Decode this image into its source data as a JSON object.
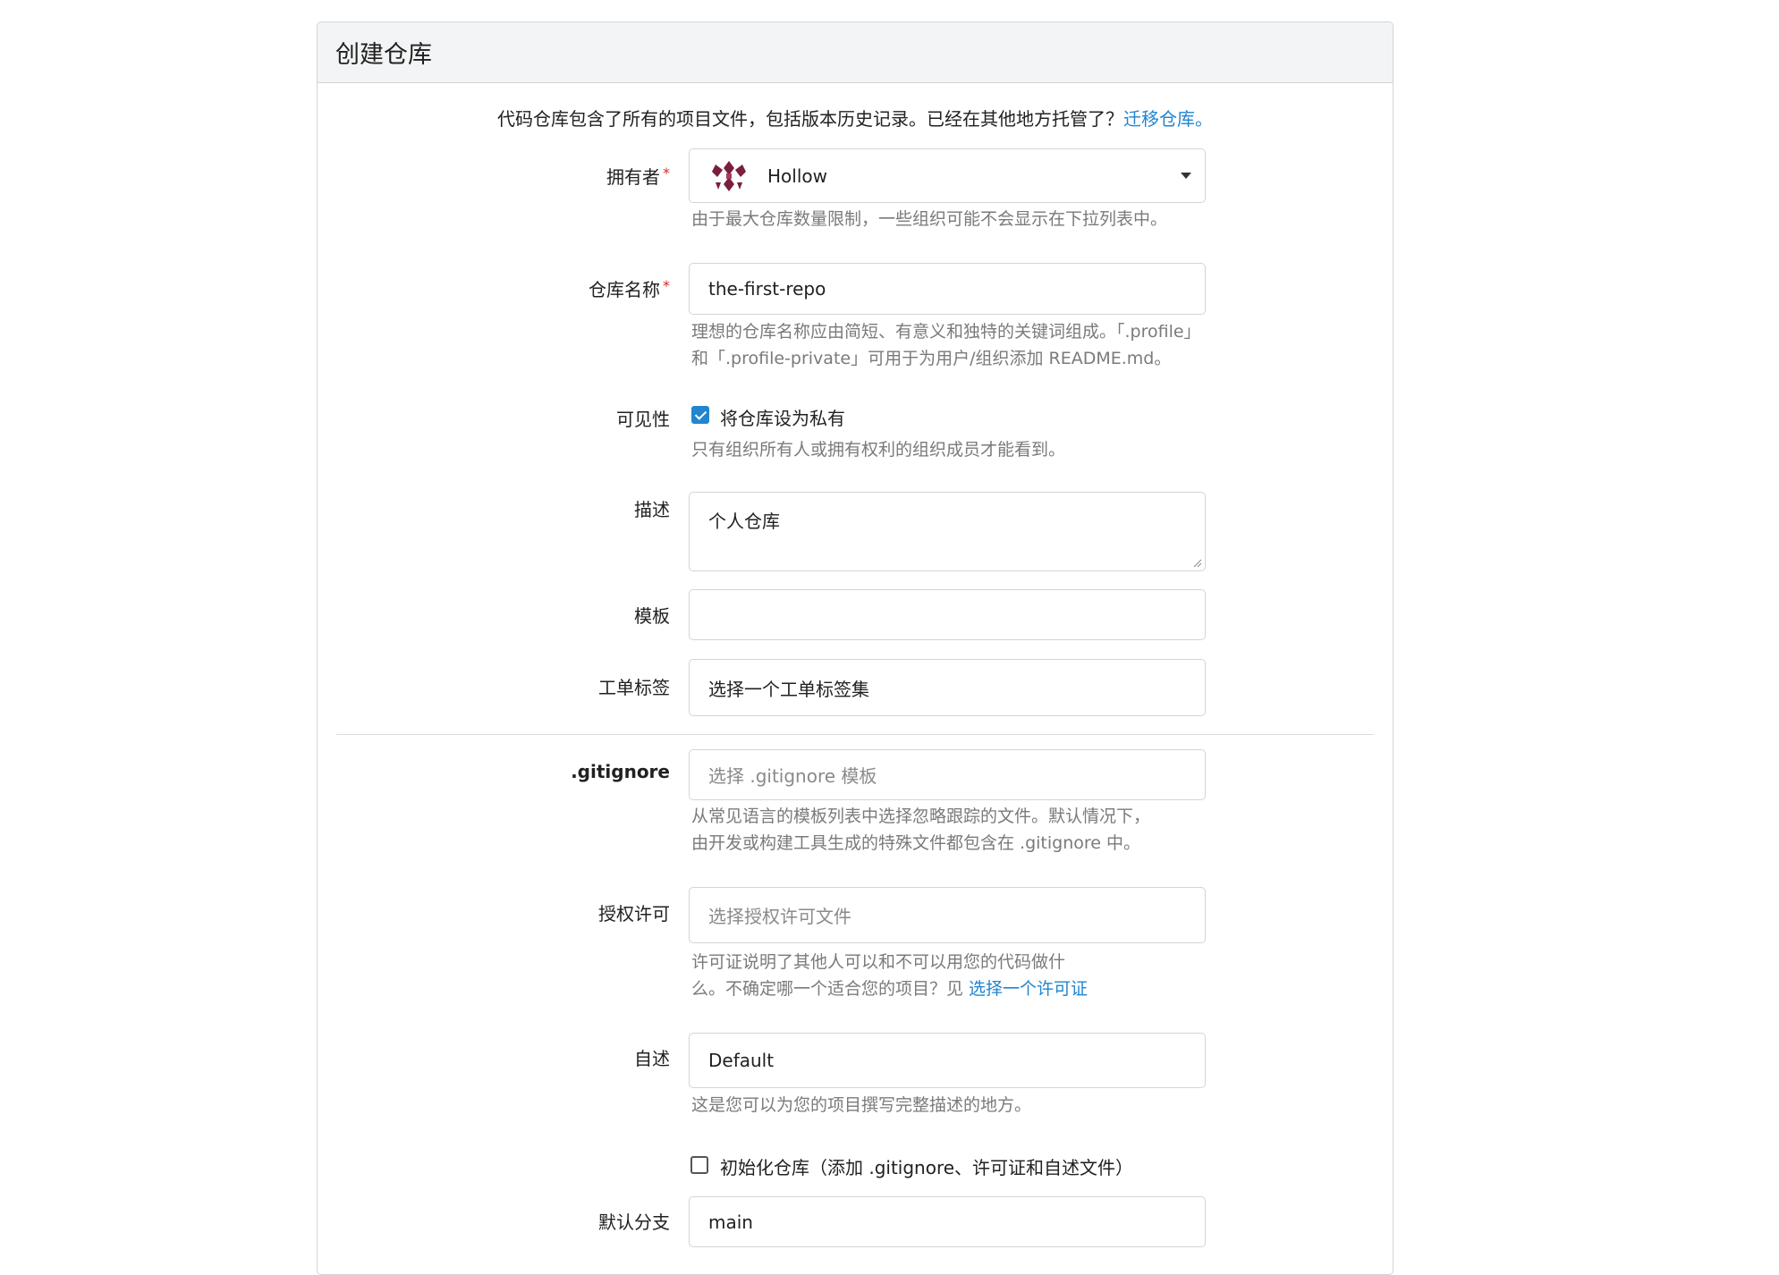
{
  "page": {
    "title": "创建仓库"
  },
  "intro": {
    "text": "代码仓库包含了所有的项目文件，包括版本历史记录。已经在其他地方托管了？",
    "link": "迁移仓库。"
  },
  "owner": {
    "label": "拥有者",
    "required_mark": "*",
    "value": "Hollow",
    "help": "由于最大仓库数量限制，一些组织可能不会显示在下拉列表中。"
  },
  "repo_name": {
    "label": "仓库名称",
    "required_mark": "*",
    "value": "the-first-repo",
    "help_line1": "理想的仓库名称应由简短、有意义和独特的关键词组成。「.profile」",
    "help_line2": "和「.profile-private」可用于为用户/组织添加 README.md。"
  },
  "visibility": {
    "label": "可见性",
    "checkbox_label": "将仓库设为私有",
    "checked": true,
    "help": "只有组织所有人或拥有权利的组织成员才能看到。"
  },
  "description": {
    "label": "描述",
    "value": "个人仓库"
  },
  "template": {
    "label": "模板",
    "value": ""
  },
  "issue_labels": {
    "label": "工单标签",
    "value": "选择一个工单标签集"
  },
  "gitignore": {
    "label": ".gitignore",
    "placeholder": "选择 .gitignore 模板",
    "help_line1": "从常见语言的模板列表中选择忽略跟踪的文件。默认情况下，",
    "help_line2": "由开发或构建工具生成的特殊文件都包含在 .gitignore 中。"
  },
  "license": {
    "label": "授权许可",
    "placeholder": "选择授权许可文件",
    "help_line1": "许可证说明了其他人可以和不可以用您的代码做什",
    "help_line2": "么。不确定哪一个适合您的项目？见 ",
    "help_link": "选择一个许可证"
  },
  "readme": {
    "label": "自述",
    "value": "Default",
    "help": "这是您可以为您的项目撰写完整描述的地方。"
  },
  "init": {
    "checkbox_label": "初始化仓库（添加 .gitignore、许可证和自述文件）",
    "checked": false
  },
  "default_branch": {
    "label": "默认分支",
    "value": "main"
  },
  "colors": {
    "accent": "#2185d0",
    "required": "#db2828",
    "header_bg": "#f3f4f5",
    "help_text": "#7a7a7a"
  }
}
